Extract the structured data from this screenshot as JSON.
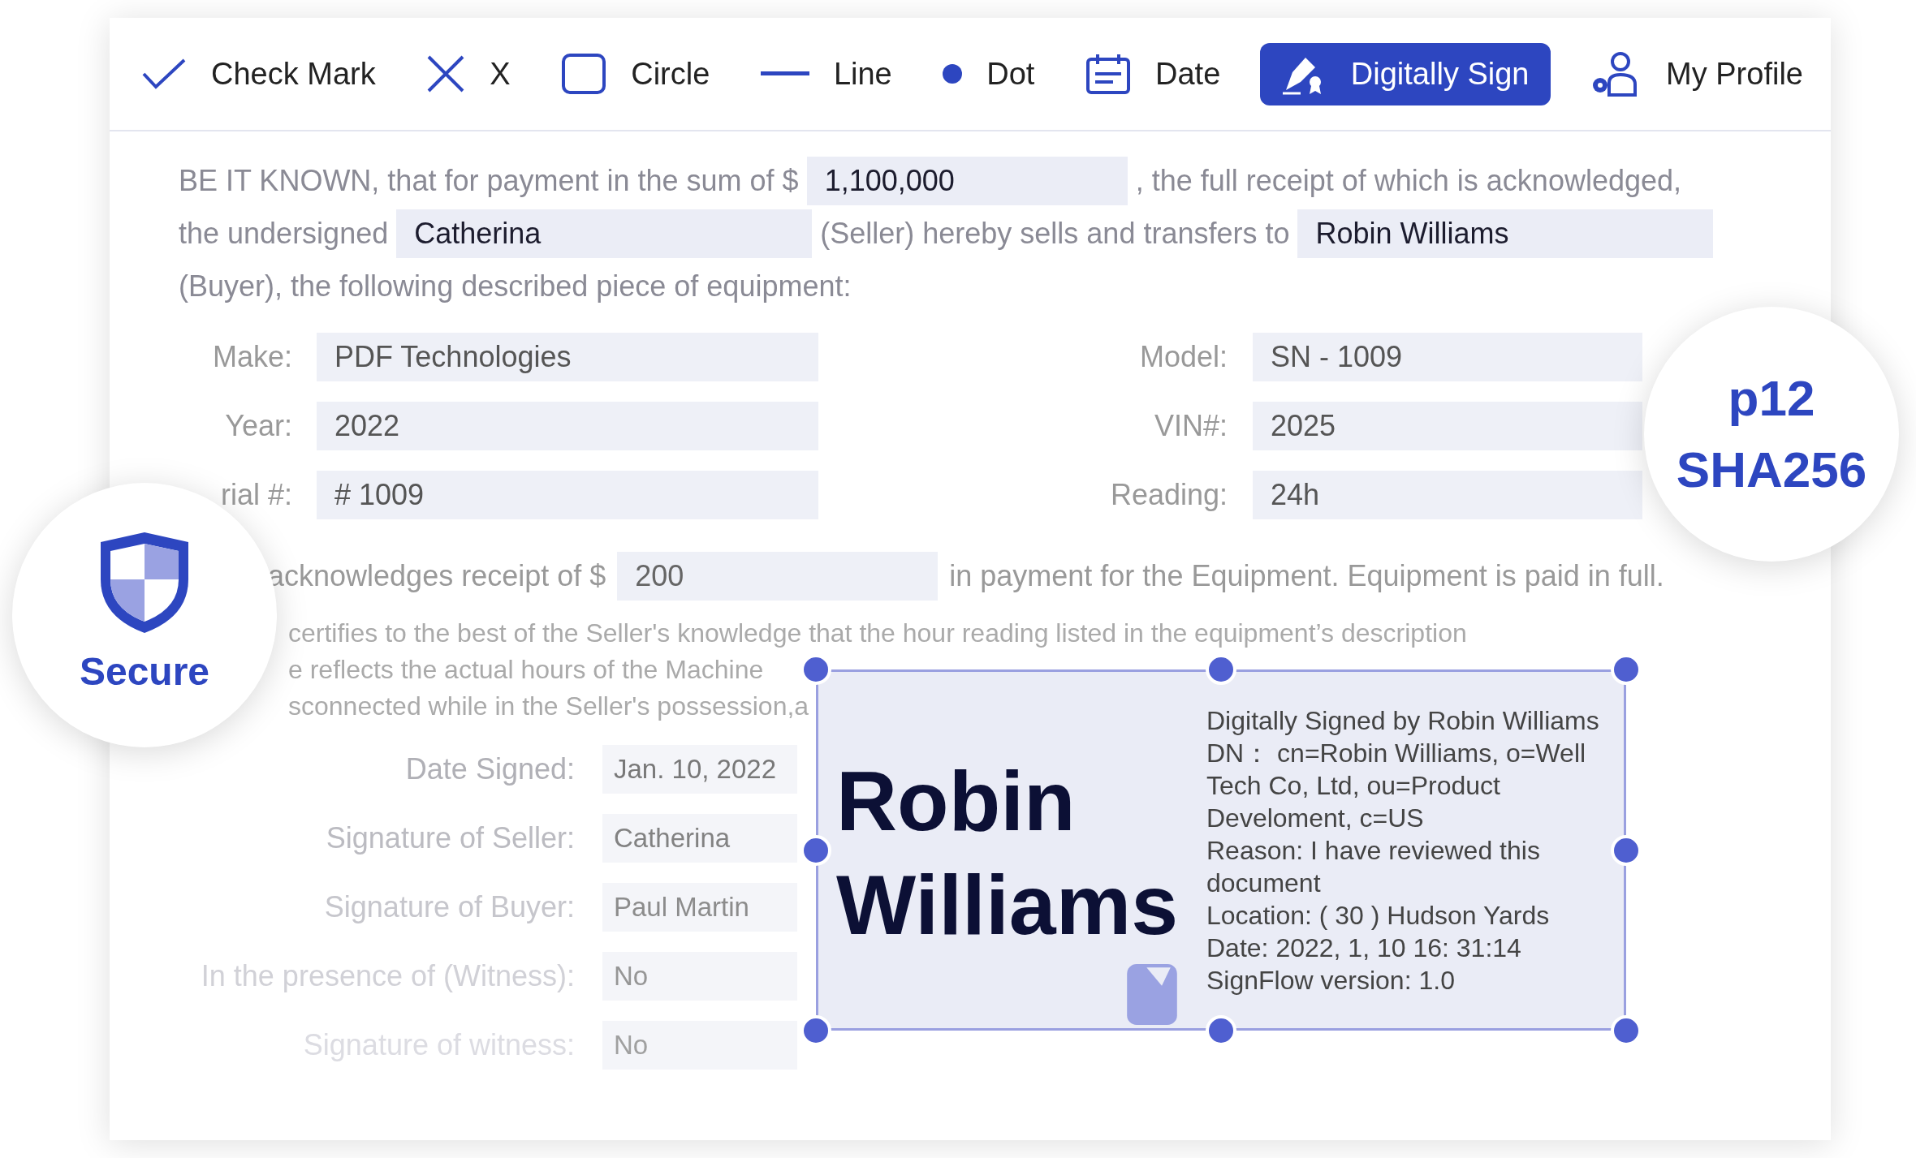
{
  "toolbar": [
    {
      "kind": "check",
      "label": "Check Mark",
      "selected": false
    },
    {
      "kind": "x",
      "label": "X",
      "selected": false
    },
    {
      "kind": "circle",
      "label": "Circle",
      "selected": false
    },
    {
      "kind": "line",
      "label": "Line",
      "selected": false
    },
    {
      "kind": "dot",
      "label": "Dot",
      "selected": false
    },
    {
      "kind": "date",
      "label": "Date",
      "selected": false
    },
    {
      "kind": "sign",
      "label": "Digitally Sign",
      "selected": true
    },
    {
      "kind": "profile",
      "label": "My Profile",
      "selected": false
    }
  ],
  "sale_paragraph": [
    [
      {
        "kind": "text",
        "text": "BE IT KNOWN, that for payment in the sum of $"
      },
      {
        "kind": "field",
        "value": "1,100,000"
      },
      {
        "kind": "text",
        "text": ", the full receipt of which is acknowledged,"
      }
    ],
    [
      {
        "kind": "text",
        "text": "the undersigned"
      },
      {
        "kind": "field",
        "value": "Catherina"
      },
      {
        "kind": "text",
        "text": "(Seller) hereby sells and transfers to"
      },
      {
        "kind": "field",
        "value": "Robin Williams"
      }
    ],
    [
      {
        "kind": "text",
        "text": "(Buyer), the following described piece of equipment:"
      }
    ]
  ],
  "equipment": [
    {
      "label": "Make:",
      "value": "PDF Technologies"
    },
    {
      "label": "Model:",
      "value": "SN - 1009"
    },
    {
      "label": "Year:",
      "value": "2022"
    },
    {
      "label": "VIN#:",
      "value": "2025"
    },
    {
      "label": "rial #:",
      "value": "# 1009"
    },
    {
      "label": "Reading:",
      "value": "24h"
    }
  ],
  "acknowledgement": {
    "text": "acknowledges receipt of $",
    "value": "200",
    "after": "in payment for the Equipment. Equipment is paid in full."
  },
  "certification_lines": [
    "certifies to the best of the Seller's knowledge that the hour reading listed in the equipment’s description",
    "e reflects the actual hours of the Machine",
    "sconnected while in the Seller's possession,a"
  ],
  "signatures": [
    {
      "label": "Date Signed:",
      "value": "Jan. 10, 2022"
    },
    {
      "label": "Signature of Seller:",
      "value": "Catherina"
    },
    {
      "label": "Signature of Buyer:",
      "value": "Paul Martin"
    },
    {
      "label": "In the presence of (Witness):",
      "value": "No"
    },
    {
      "label": "Signature of witness:",
      "value": "No"
    }
  ],
  "signature_box": {
    "name": "Robin Williams",
    "details": [
      "Digitally Signed by Robin Williams",
      "DN： cn=Robin Williams, o=Well Tech Co, Ltd, ou=Product Develoment, c=US",
      "Reason: I have reviewed this document",
      "Location: ( 30 ) Hudson Yards",
      "Date: 2022, 1, 10 16: 31:14",
      "SignFlow version: 1.0"
    ]
  },
  "secure_badge": {
    "label": "Secure"
  },
  "hash_badge": {
    "lines": [
      "p12",
      "SHA256"
    ]
  }
}
